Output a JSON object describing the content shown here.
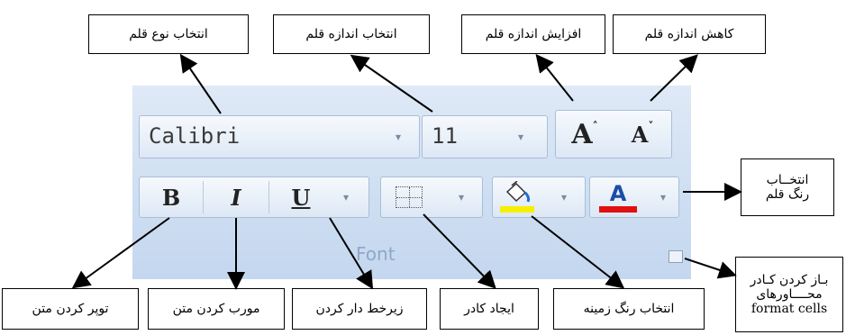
{
  "ribbon": {
    "font_name": "Calibri",
    "font_size": "11",
    "grow_font_glyph": "A",
    "shrink_font_glyph": "A",
    "bold_glyph": "B",
    "italic_glyph": "I",
    "underline_glyph": "U",
    "group_label": "Font",
    "dropdown_glyph": "▾",
    "highlight_color": "#f6f000",
    "font_color": "#e01010"
  },
  "callouts": {
    "font_type": "انتخاب نوع قلم",
    "font_size": "انتخاب اندازه قلم",
    "grow_font": "افزایش اندازه قلم",
    "shrink_font": "کاهش اندازه قلم",
    "font_color_line1": "انتخــاب",
    "font_color_line2": "رنگ قلم",
    "bold": "توپر کردن متن",
    "italic": "مورب کردن متن",
    "underline": "زیرخط دار کردن",
    "borders": "ایجاد کادر",
    "fill_color": "انتخاب رنگ زمینه",
    "dialog_line1": "بـاز کردن کـادر",
    "dialog_line2": "محــــاورهای",
    "dialog_line3": "format cells"
  }
}
